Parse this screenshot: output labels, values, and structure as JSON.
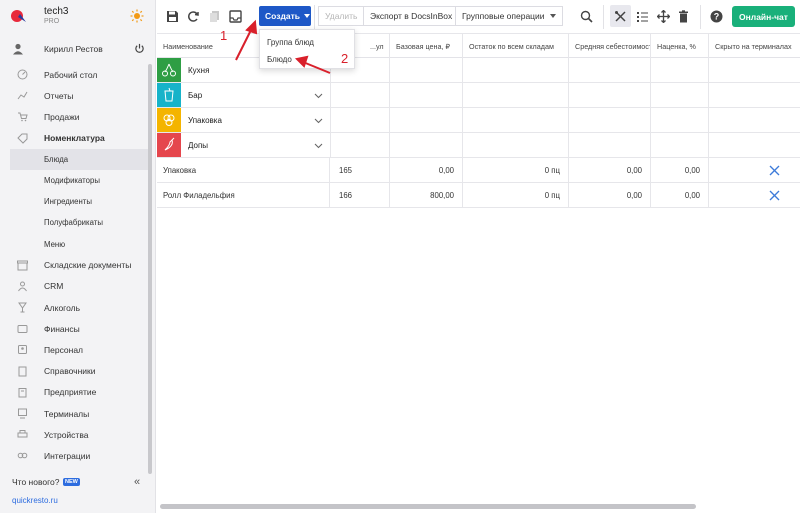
{
  "brand": {
    "name": "tech3",
    "plan": "PRO"
  },
  "user": {
    "name": "Кирилл Рестов"
  },
  "nav": [
    {
      "label": "Рабочий стол",
      "icon": "dashboard-icon"
    },
    {
      "label": "Отчеты",
      "icon": "chart-icon"
    },
    {
      "label": "Продажи",
      "icon": "cart-icon"
    },
    {
      "label": "Номенклатура",
      "icon": "tag-icon"
    },
    {
      "label": "Блюда",
      "icon": ""
    },
    {
      "label": "Модификаторы",
      "icon": ""
    },
    {
      "label": "Ингредиенты",
      "icon": ""
    },
    {
      "label": "Полуфабрикаты",
      "icon": ""
    },
    {
      "label": "Меню",
      "icon": ""
    },
    {
      "label": "Складские документы",
      "icon": "box-icon"
    },
    {
      "label": "CRM",
      "icon": "people-icon"
    },
    {
      "label": "Алкоголь",
      "icon": "glass-icon"
    },
    {
      "label": "Финансы",
      "icon": "wallet-icon"
    },
    {
      "label": "Персонал",
      "icon": "staff-icon"
    },
    {
      "label": "Справочники",
      "icon": "book-icon"
    },
    {
      "label": "Предприятие",
      "icon": "building-icon"
    },
    {
      "label": "Терминалы",
      "icon": "terminal-icon"
    },
    {
      "label": "Устройства",
      "icon": "printer-icon"
    },
    {
      "label": "Интеграции",
      "icon": "link-icon"
    }
  ],
  "footer": {
    "whats_new": "Что нового?",
    "badge": "NEW",
    "site": "quickresto.ru"
  },
  "toolbar": {
    "create": "Создать",
    "delete": "Удалить",
    "export": "Экспорт в DocsInBox",
    "group_ops": "Групповые операции",
    "chat": "Онлайн-чат"
  },
  "dropdown": {
    "items": [
      "Группа блюд",
      "Блюдо"
    ]
  },
  "annotations": [
    "1",
    "2"
  ],
  "table": {
    "headers": [
      "Наименование",
      "...ул",
      "Базовая цена, ₽",
      "Остаток по всем складам",
      "Средняя себестоимость",
      "Наценка, %",
      "Скрыто на терминалах"
    ],
    "groups": [
      {
        "name": "Кухня",
        "color": "#2e9e44",
        "icon": "cherries-icon"
      },
      {
        "name": "Бар",
        "color": "#17b3c9",
        "icon": "drink-icon"
      },
      {
        "name": "Упаковка",
        "color": "#f4b400",
        "icon": "circles-icon"
      },
      {
        "name": "Допы",
        "color": "#e5464d",
        "icon": "pepper-icon"
      }
    ],
    "rows": [
      {
        "name": "Упаковка",
        "code": "165",
        "price": "0,00",
        "stock": "0 пц",
        "cost": "0,00",
        "markup": "0,00",
        "hidden": "x"
      },
      {
        "name": "Ролл Филадельфия",
        "code": "166",
        "price": "800,00",
        "stock": "0 пц",
        "cost": "0,00",
        "markup": "0,00",
        "hidden": "x"
      }
    ]
  },
  "colors": {
    "primary": "#1e58c7",
    "chat": "#19b07a",
    "annotation": "#d9202b",
    "hidden_x": "#3d7bd9"
  }
}
